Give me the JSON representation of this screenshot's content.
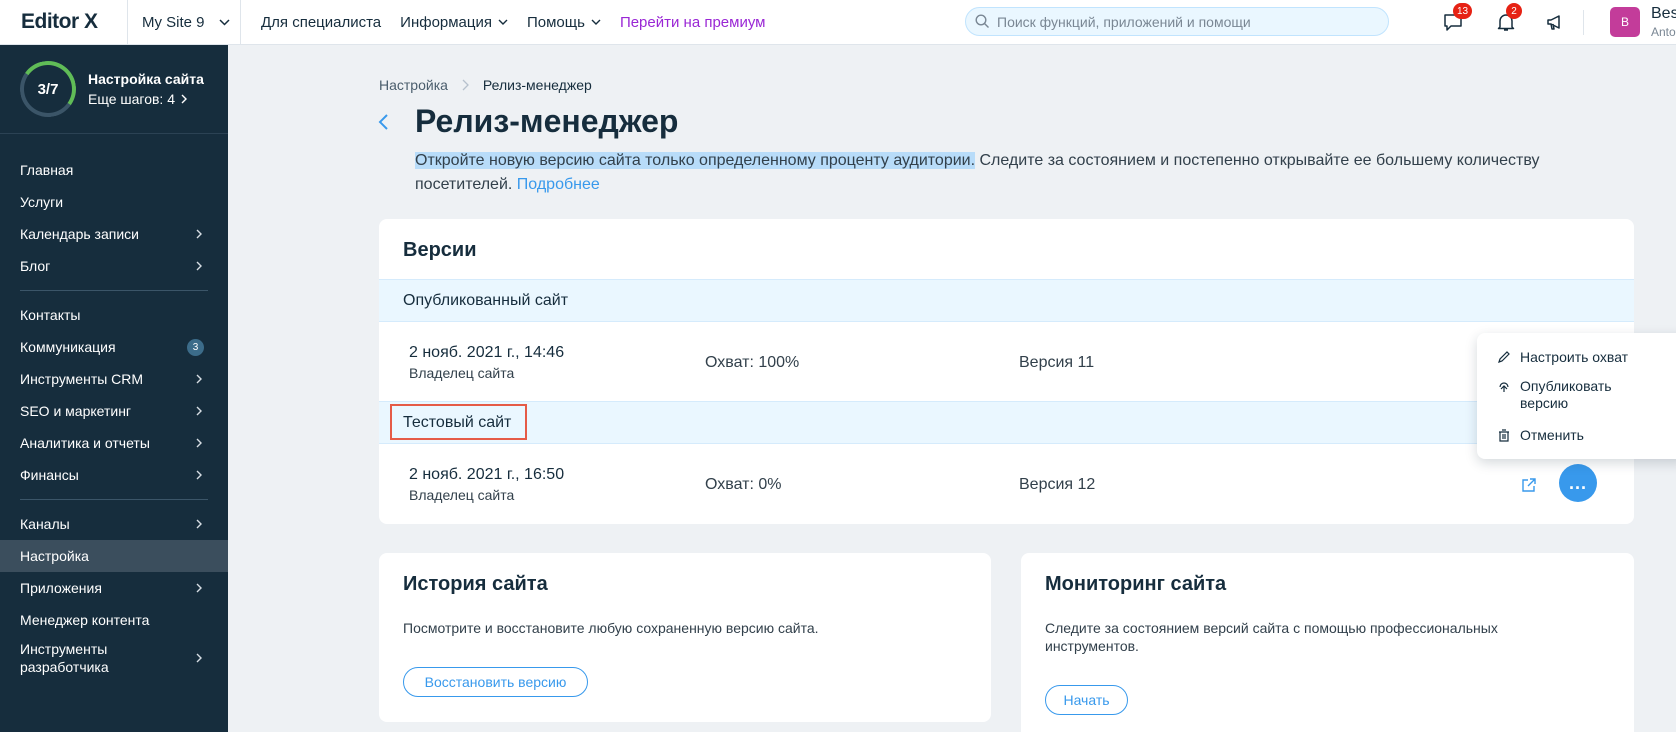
{
  "topbar": {
    "logo": "Editor X",
    "site_name": "My Site 9",
    "nav": [
      "Для специалиста",
      "Информация",
      "Помощь",
      "Перейти на премиум"
    ],
    "search_placeholder": "Поиск функций, приложений и помощи",
    "messages_count": "13",
    "notifications_count": "2",
    "avatar_initial": "B",
    "user_name": "Bes",
    "user_sub": "Anto"
  },
  "sidebar": {
    "progress": "3/7",
    "progress_fraction": 0.43,
    "setup_title": "Настройка сайта",
    "setup_steps": "Еще шагов: 4",
    "group1": [
      {
        "label": "Главная",
        "arrow": false
      },
      {
        "label": "Услуги",
        "arrow": false
      },
      {
        "label": "Календарь записи",
        "arrow": true
      },
      {
        "label": "Блог",
        "arrow": true
      }
    ],
    "group2": [
      {
        "label": "Контакты",
        "arrow": false
      },
      {
        "label": "Коммуникация",
        "badge": "3"
      },
      {
        "label": "Инструменты CRM",
        "arrow": true
      },
      {
        "label": "SEO и маркетинг",
        "arrow": true
      },
      {
        "label": "Аналитика и отчеты",
        "arrow": true
      },
      {
        "label": "Финансы",
        "arrow": true
      }
    ],
    "group3": [
      {
        "label": "Каналы",
        "arrow": true
      },
      {
        "label": "Настройка",
        "active": true
      },
      {
        "label": "Приложения",
        "arrow": true
      },
      {
        "label": "Менеджер контента",
        "arrow": false
      },
      {
        "label": "Инструменты разработчика",
        "arrow": true
      }
    ]
  },
  "breadcrumb": {
    "parent": "Настройка",
    "current": "Релиз-менеджер"
  },
  "page": {
    "title": "Релиз-менеджер",
    "intro_highlight": "Откройте новую версию сайта только определенному проценту аудитории.",
    "intro_rest": " Следите за состоянием и постепенно открывайте ее большему количеству посетителей.",
    "intro_link": "Подробнее"
  },
  "versions": {
    "title": "Версии",
    "published_label": "Опубликованный сайт",
    "published": {
      "date": "2 нояб. 2021 г., 14:46",
      "owner": "Владелец сайта",
      "reach": "Охват: 100%",
      "version": "Версия 11"
    },
    "test_label": "Тестовый сайт",
    "test": {
      "date": "2 нояб. 2021 г., 16:50",
      "owner": "Владелец сайта",
      "reach": "Охват: 0%",
      "version": "Версия 12"
    },
    "more_label": "..."
  },
  "popup": {
    "items": [
      "Настроить охват",
      "Опубликовать версию",
      "Отменить"
    ]
  },
  "history": {
    "title": "История сайта",
    "text": "Посмотрите и восстановите любую сохраненную версию сайта.",
    "button": "Восстановить версию"
  },
  "monitor": {
    "title": "Мониторинг сайта",
    "text": "Следите за состоянием версий сайта с помощью профессиональных инструментов.",
    "button": "Начать"
  }
}
